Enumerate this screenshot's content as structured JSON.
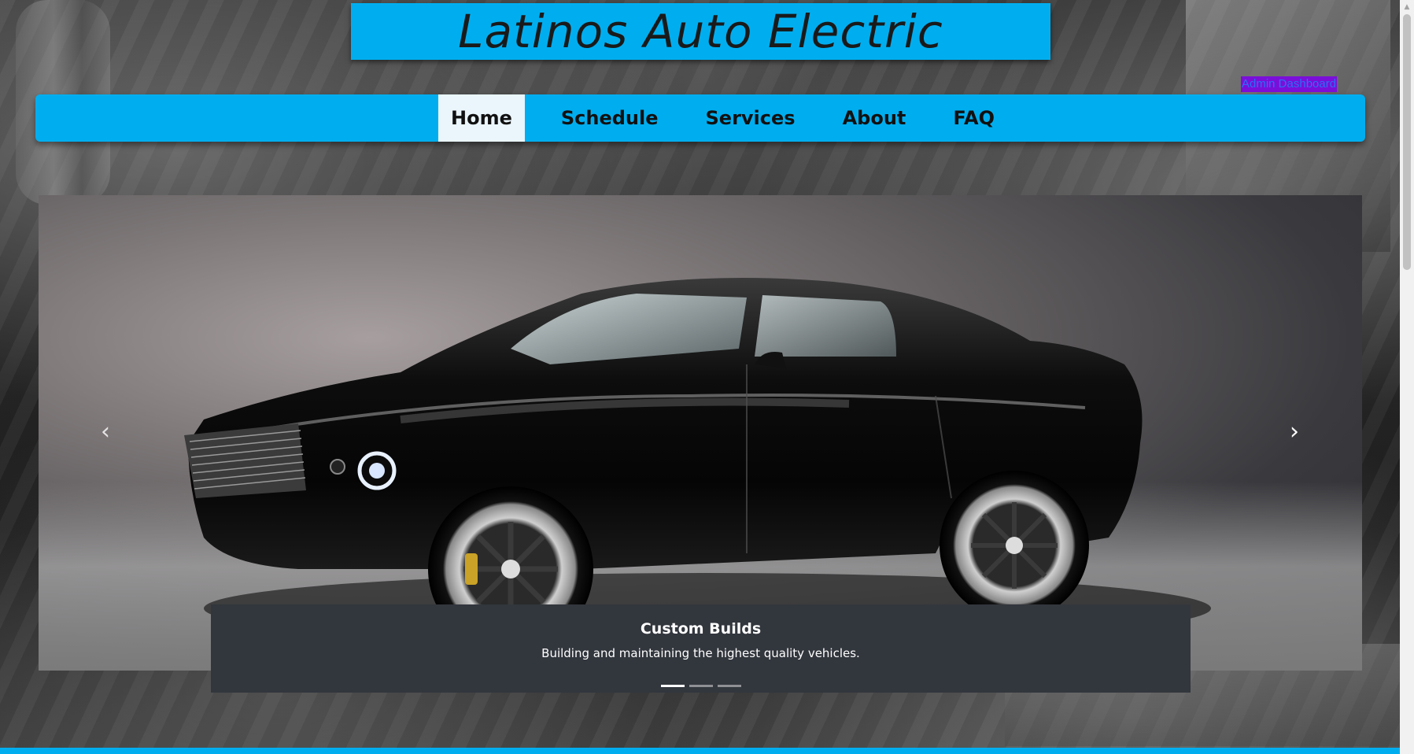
{
  "site": {
    "title": "Latinos Auto Electric"
  },
  "admin": {
    "label": "Admin Dashboard"
  },
  "nav": {
    "items": [
      {
        "label": "Home",
        "active": true
      },
      {
        "label": "Schedule",
        "active": false
      },
      {
        "label": "Services",
        "active": false
      },
      {
        "label": "About",
        "active": false
      },
      {
        "label": "FAQ",
        "active": false
      }
    ]
  },
  "carousel": {
    "controls": {
      "prev_icon": "‹",
      "next_icon": "›"
    },
    "caption": {
      "title": "Custom Builds",
      "text": "Building and maintaining the highest quality vehicles."
    },
    "slide_count": 3,
    "active_slide": 1
  },
  "colors": {
    "brand_blue": "#00aeef",
    "caption_bg": "#32363d",
    "admin_bg": "#7b0fd9"
  }
}
